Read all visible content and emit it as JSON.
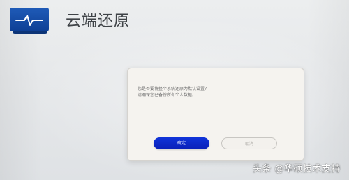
{
  "app": {
    "title": "云端还原"
  },
  "dialog": {
    "message_line1": "您是否要将整个系统还原为默认设置？",
    "message_line2": "请确保您已备份所有个人数据。",
    "confirm_label": "确定",
    "cancel_label": "取消"
  },
  "watermark": {
    "text": "头条 @华硕技术支持"
  },
  "colors": {
    "icon_blue": "#1f5bb8",
    "confirm_blue": "#0a20b8",
    "dialog_bg": "#f5f3ef",
    "background": "#e6e8ea"
  },
  "icons": {
    "app_icon": "monitor-pulse-icon"
  }
}
